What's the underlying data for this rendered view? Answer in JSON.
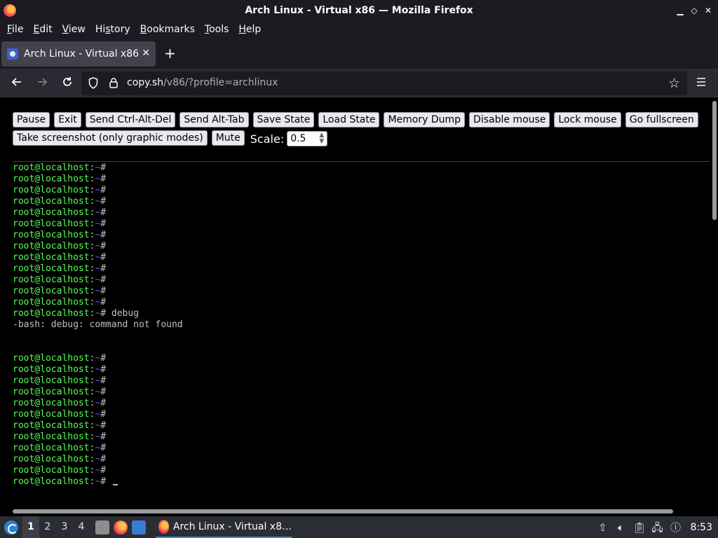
{
  "window": {
    "title": "Arch Linux - Virtual x86 — Mozilla Firefox",
    "controls": {
      "minimize": "▁",
      "restore": "◇",
      "close": "✕"
    }
  },
  "menu": [
    "File",
    "Edit",
    "View",
    "History",
    "Bookmarks",
    "Tools",
    "Help"
  ],
  "menu_accel": [
    "F",
    "E",
    "V",
    "s",
    "B",
    "T",
    "H"
  ],
  "tab": {
    "label": "Arch Linux - Virtual x86",
    "close": "✕",
    "new_tab": "+"
  },
  "nav": {
    "url_host": "copy.sh",
    "url_rest": "/v86/?profile=archlinux"
  },
  "controls": {
    "row1": [
      "Pause",
      "Exit",
      "Send Ctrl-Alt-Del",
      "Send Alt-Tab",
      "Save State",
      "Load State",
      "Memory Dump",
      "Disable mouse",
      "Lock mouse",
      "Go fullscreen"
    ],
    "row2": [
      "Take screenshot (only graphic modes)",
      "Mute"
    ],
    "scale_label": "Scale:",
    "scale_value": "0.5"
  },
  "terminal": {
    "user": "root@localhost",
    "sep": ":",
    "path": "~",
    "suffix": "#",
    "lines": [
      {
        "type": "prompt",
        "cmd": ""
      },
      {
        "type": "prompt",
        "cmd": ""
      },
      {
        "type": "prompt",
        "cmd": ""
      },
      {
        "type": "prompt",
        "cmd": ""
      },
      {
        "type": "prompt",
        "cmd": ""
      },
      {
        "type": "prompt",
        "cmd": ""
      },
      {
        "type": "prompt",
        "cmd": ""
      },
      {
        "type": "prompt",
        "cmd": ""
      },
      {
        "type": "prompt",
        "cmd": ""
      },
      {
        "type": "prompt",
        "cmd": ""
      },
      {
        "type": "prompt",
        "cmd": ""
      },
      {
        "type": "prompt",
        "cmd": ""
      },
      {
        "type": "prompt",
        "cmd": ""
      },
      {
        "type": "prompt",
        "cmd": " debug"
      },
      {
        "type": "output",
        "text": "-bash: debug: command not found"
      },
      {
        "type": "blank"
      },
      {
        "type": "blank"
      },
      {
        "type": "prompt",
        "cmd": ""
      },
      {
        "type": "prompt",
        "cmd": ""
      },
      {
        "type": "prompt",
        "cmd": ""
      },
      {
        "type": "prompt",
        "cmd": ""
      },
      {
        "type": "prompt",
        "cmd": ""
      },
      {
        "type": "prompt",
        "cmd": ""
      },
      {
        "type": "prompt",
        "cmd": ""
      },
      {
        "type": "prompt",
        "cmd": ""
      },
      {
        "type": "prompt",
        "cmd": ""
      },
      {
        "type": "prompt",
        "cmd": ""
      },
      {
        "type": "prompt",
        "cmd": ""
      },
      {
        "type": "prompt",
        "cmd": " ",
        "cursor": true
      }
    ]
  },
  "taskbar": {
    "workspaces": [
      "1",
      "2",
      "3",
      "4"
    ],
    "active_workspace": 0,
    "task_label": "Arch Linux - Virtual x8…",
    "clock": "8:53"
  },
  "colors": {
    "prompt_user": "#55ff55",
    "prompt_path": "#5555ff",
    "terminal_text": "#c0c0c0"
  }
}
